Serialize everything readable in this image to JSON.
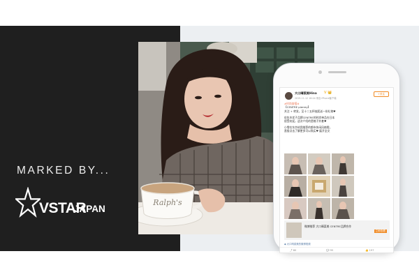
{
  "banner": {
    "tagline": "MARKED BY...",
    "logo_main": "VSTAR",
    "logo_sub": "JAPAN",
    "photo_cup_text": "Ralph's",
    "colors": {
      "dark_panel": "#1f1f1f",
      "light_panel": "#eceff2",
      "weibo_orange": "#f08a24",
      "weibo_link": "#eb7350"
    }
  },
  "post": {
    "username": "大口晴菜美Hina",
    "username_icons": "V 👑",
    "meta": "2019-11-12 18:04 来自 iPhone客户端",
    "follow": "+关注",
    "tag_line": "#时尚穿搭#",
    "subtitle": "【CENTRE pierrey】",
    "lines": [
      "关注 + 转发，至十二五杯抽奖送一份礼物♥",
      "",
      "佐佐木优子品牌CENTRE的时尚单品在日本",
      "很受欢迎，这次介绍的是格子外套♥",
      "",
      "小雪在东京给我推荐的都市休闲风格哦，",
      "直接点击了解更多可以购买♥ 展开全文"
    ],
    "source": "◆ 大口晴菜美的微博视频",
    "card_title": "微博推荐 大口晴菜美 CENTRE品牌合作",
    "card_tag": "立即查看",
    "actions": {
      "share": "⤴ 80",
      "comment": "💬 95",
      "like": "👍 197"
    }
  }
}
